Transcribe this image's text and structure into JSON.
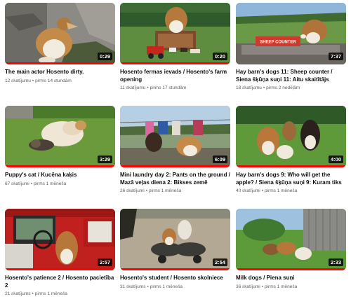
{
  "videos": [
    {
      "title": "The main actor Hosento dirty.",
      "views": "12 skatījumu",
      "age": "pirms 14 stundām",
      "duration": "0:29",
      "watched": 1.0
    },
    {
      "title": "Hosento fermas ievads / Hosento's farm opening",
      "views": "11 skatījumu",
      "age": "pirms 17 stundām",
      "duration": "0:20",
      "watched": 1.0
    },
    {
      "title": "Hay barn's dogs 11: Sheep counter / Siena šķūņa suņi 11: Aitu skaitītājs",
      "views": "18 skatījumu",
      "age": "pirms 2 nedēļām",
      "duration": "7:37",
      "watched": 0.0
    },
    {
      "title": "Puppy's cat / Kucēna kaķis",
      "views": "67 skatījumi",
      "age": "pirms 1 mēneša",
      "duration": "3:29",
      "watched": 1.0
    },
    {
      "title": "Mini laundry day 2: Pants on the ground / Mazā veļas diena 2: Bikses zemē",
      "views": "26 skatījumi",
      "age": "pirms 1 mēneša",
      "duration": "6:09",
      "watched": 1.0
    },
    {
      "title": "Hay barn's dogs 9: Who will get the apple? / Siena šķūņa suņi 9: Kuram tiks ābols?",
      "views": "40 skatījumi",
      "age": "pirms 1 mēneša",
      "duration": "4:00",
      "watched": 1.0
    },
    {
      "title": "Hosento's patience 2 / Hosento pacietība 2",
      "views": "21 skatījums",
      "age": "pirms 1 mēneša",
      "duration": "2:57",
      "watched": 1.0
    },
    {
      "title": "Hosento's student / Hosento skolniece",
      "views": "31 skatījums",
      "age": "pirms 1 mēneša",
      "duration": "2:54",
      "watched": 1.0
    },
    {
      "title": "Milk dogs / Piena suņi",
      "views": "36 skatījumi",
      "age": "pirms 1 mēneša",
      "duration": "2:33",
      "watched": 1.0
    }
  ],
  "thumbnail_signs": {
    "sheep_counter": "SHEEP COUNTER"
  },
  "colors": {
    "progress": "#ff0000",
    "duration_bg": "#000000",
    "meta_text": "#606060"
  },
  "separator": "•"
}
